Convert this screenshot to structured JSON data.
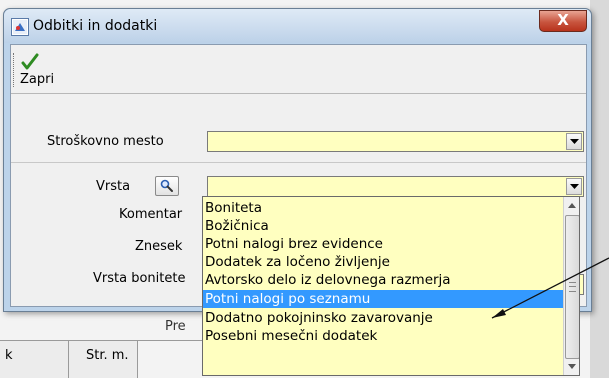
{
  "window": {
    "title": "Odbitki in dodatki",
    "close_glyph": "X"
  },
  "toolbar": {
    "close_label": "Zapri"
  },
  "form": {
    "cost_center_label": "Stroškovno mesto",
    "type_label": "Vrsta",
    "comment_label": "Komentar",
    "amount_label": "Znesek",
    "benefit_type_label": "Vrsta bonitete"
  },
  "dropdown": {
    "selected_index": 5,
    "items": [
      "Boniteta",
      "Božičnica",
      "Potni nalogi brez evidence",
      "Dodatek za ločeno življenje",
      "Avtorsko delo iz delovnega razmerja",
      "Potni nalogi po seznamu",
      "Dodatno pokojninsko zavarovanje",
      "Posebni mesečni dodatek"
    ]
  },
  "background": {
    "tab_fragment": "Pre",
    "grid_col_fragment": "k",
    "grid_col": "Str. m."
  },
  "colors": {
    "field_bg": "#ffffc0",
    "selection": "#3399ff",
    "close_button": "#c8553f",
    "check_icon": "#2e8b22"
  },
  "icons": {
    "app": "app-icon",
    "close": "close-icon",
    "toolbar_close": "checkmark-icon",
    "search": "magnifier-icon"
  }
}
